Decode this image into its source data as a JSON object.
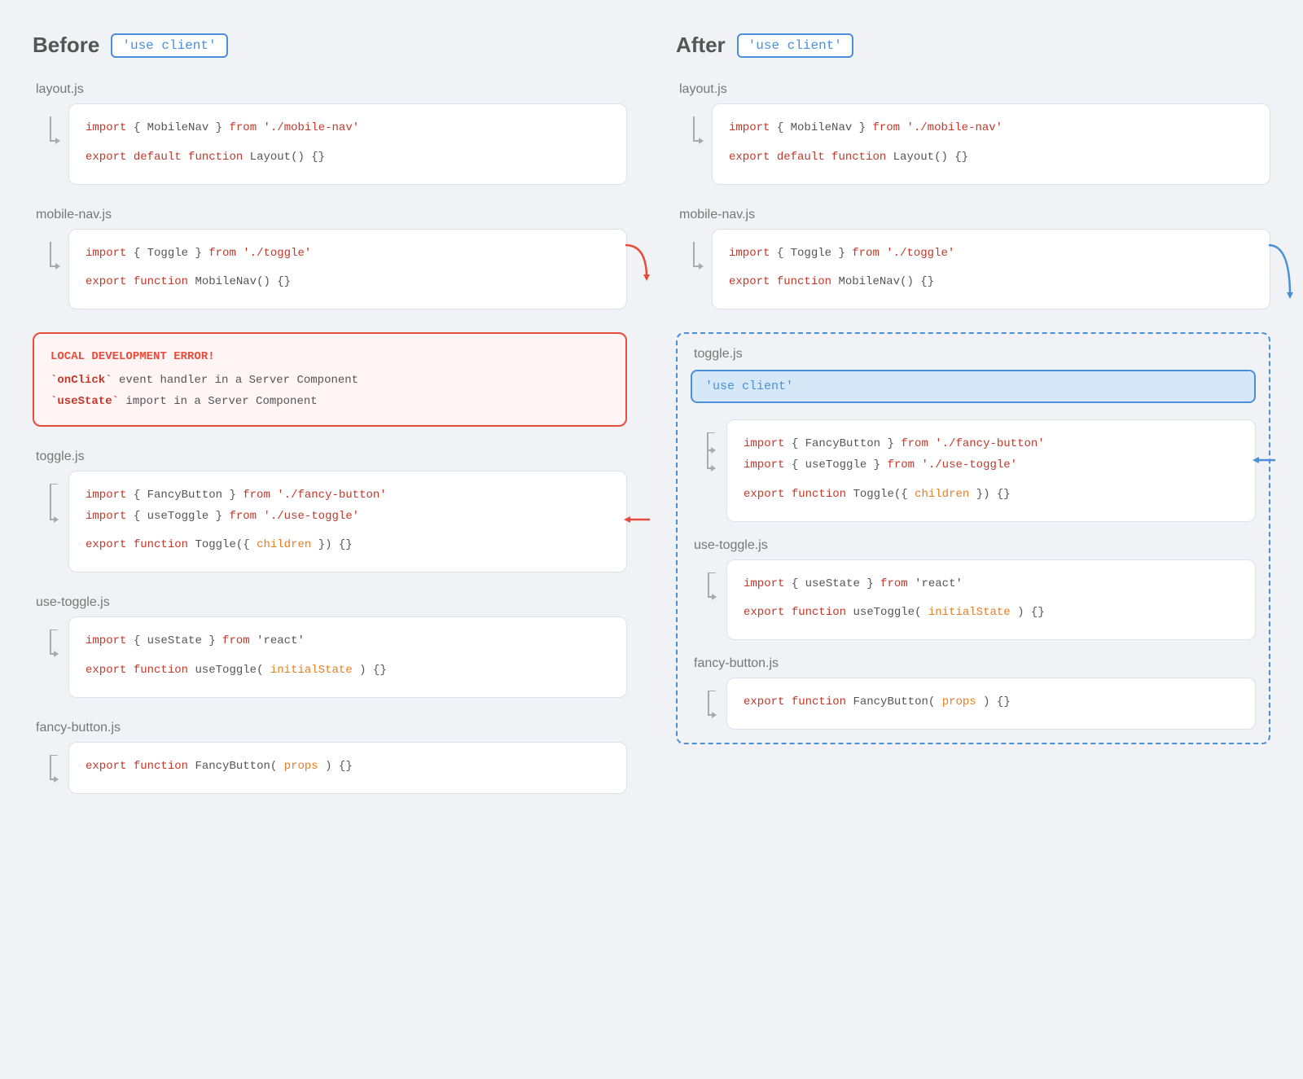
{
  "before": {
    "title": "Before",
    "badge": "'use client'",
    "files": [
      {
        "name": "layout.js",
        "lines": [
          {
            "type": "import",
            "text": "import { MobileNav } from './mobile-nav'"
          },
          {
            "type": "gap"
          },
          {
            "type": "export",
            "text": "export default function Layout() {}"
          }
        ]
      },
      {
        "name": "mobile-nav.js",
        "lines": [
          {
            "type": "import",
            "text": "import { Toggle } from './toggle'"
          },
          {
            "type": "gap"
          },
          {
            "type": "export",
            "text": "export function MobileNav() {}"
          }
        ]
      },
      {
        "name": "toggle.js",
        "lines": [
          {
            "type": "import",
            "text": "import { FancyButton } from './fancy-button'"
          },
          {
            "type": "import2",
            "text": "import { useToggle } from './use-toggle'"
          },
          {
            "type": "gap"
          },
          {
            "type": "export",
            "text": "export function Toggle({ children }) {}"
          }
        ]
      },
      {
        "name": "use-toggle.js",
        "lines": [
          {
            "type": "import",
            "text": "import { useState } from 'react'"
          },
          {
            "type": "gap"
          },
          {
            "type": "export",
            "text": "export function useToggle(initialState) {}"
          }
        ]
      },
      {
        "name": "fancy-button.js",
        "lines": [
          {
            "type": "export",
            "text": "export function FancyButton(props) {}"
          }
        ]
      }
    ],
    "error": {
      "title": "LOCAL DEVELOPMENT ERROR!",
      "lines": [
        "`onClick` event handler in a Server Component",
        "`useState` import in a Server Component"
      ]
    }
  },
  "after": {
    "title": "After",
    "badge": "'use client'",
    "files_top": [
      {
        "name": "layout.js",
        "lines": [
          {
            "type": "import",
            "text": "import { MobileNav } from './mobile-nav'"
          },
          {
            "type": "gap"
          },
          {
            "type": "export",
            "text": "export default function Layout() {}"
          }
        ]
      },
      {
        "name": "mobile-nav.js",
        "lines": [
          {
            "type": "import",
            "text": "import { Toggle } from './toggle'"
          },
          {
            "type": "gap"
          },
          {
            "type": "export",
            "text": "export function MobileNav() {}"
          }
        ]
      }
    ],
    "boundary_label": "toggle.js",
    "use_client_bar": "'use client'",
    "files_boundary": [
      {
        "name": "toggle.js",
        "use_client": true,
        "lines": [
          {
            "type": "import",
            "text": "import { FancyButton } from './fancy-button'"
          },
          {
            "type": "import2",
            "text": "import { useToggle } from './use-toggle'"
          },
          {
            "type": "gap"
          },
          {
            "type": "export",
            "text": "export function Toggle({ children }) {}"
          }
        ]
      },
      {
        "name": "use-toggle.js",
        "lines": [
          {
            "type": "import",
            "text": "import { useState } from 'react'"
          },
          {
            "type": "gap"
          },
          {
            "type": "export",
            "text": "export function useToggle(initialState) {}"
          }
        ]
      },
      {
        "name": "fancy-button.js",
        "lines": [
          {
            "type": "export",
            "text": "export function FancyButton(props) {}"
          }
        ]
      }
    ]
  },
  "colors": {
    "keyword_red": "#c0392b",
    "string_red": "#c0392b",
    "orange": "#e67e22",
    "blue": "#4a90d9",
    "error_red": "#e74c3c",
    "text_dark": "#555555",
    "text_gray": "#777777",
    "bg_light": "#f0f2f5"
  },
  "labels": {
    "before": "Before",
    "after": "After",
    "badge_before": "'use client'",
    "badge_after": "'use client'",
    "use_client_directive": "'use client'",
    "error_title": "LOCAL DEVELOPMENT ERROR!",
    "error_line1": "`onClick` event handler in a Server Component",
    "error_line2": "`useState` import in a Server Component",
    "layout_js": "layout.js",
    "mobile_nav_js": "mobile-nav.js",
    "toggle_js": "toggle.js",
    "use_toggle_js": "use-toggle.js",
    "fancy_button_js": "fancy-button.js"
  }
}
